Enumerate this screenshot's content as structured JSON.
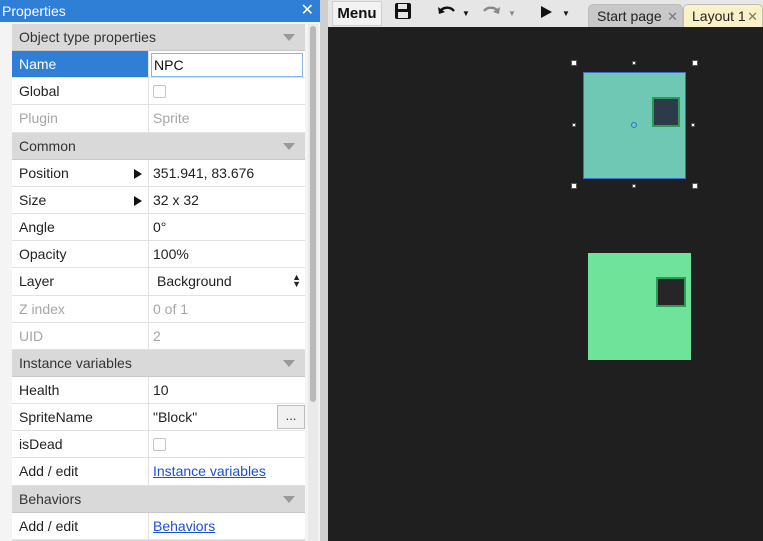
{
  "panel": {
    "title": "Properties",
    "close_glyph": "✕",
    "sections": {
      "object_type": "Object type properties",
      "common": "Common",
      "instance_vars": "Instance variables",
      "behaviors": "Behaviors"
    },
    "object_type": {
      "name_label": "Name",
      "name_value": "NPC",
      "global_label": "Global",
      "global_checked": false,
      "plugin_label": "Plugin",
      "plugin_value": "Sprite"
    },
    "common": {
      "position_label": "Position",
      "position_value": "351.941, 83.676",
      "size_label": "Size",
      "size_value": "32 x 32",
      "angle_label": "Angle",
      "angle_value": "0°",
      "opacity_label": "Opacity",
      "opacity_value": "100%",
      "layer_label": "Layer",
      "layer_value": "Background",
      "zindex_label": "Z index",
      "zindex_value": "0 of 1",
      "uid_label": "UID",
      "uid_value": "2"
    },
    "instance_vars": {
      "health_label": "Health",
      "health_value": "10",
      "spritename_label": "SpriteName",
      "spritename_value": "\"Block\"",
      "spritename_button": "...",
      "isdead_label": "isDead",
      "isdead_checked": false,
      "addedit_label": "Add / edit",
      "addedit_link": "Instance variables"
    },
    "behaviors": {
      "addedit_label": "Add / edit",
      "addedit_link": "Behaviors"
    }
  },
  "toolbar": {
    "menu_label": "Menu",
    "icons": [
      "save-icon",
      "undo-icon",
      "redo-icon",
      "play-icon"
    ],
    "tabs": [
      {
        "label": "Start page",
        "active": false
      },
      {
        "label": "Layout 1",
        "active": true
      }
    ],
    "tab_close_glyph": "✕"
  },
  "colors": {
    "accent": "#2f7fd6",
    "canvas_bg": "#1f1f1f",
    "selected_sprite": "#6ec8b4",
    "other_sprite": "#6fe39a",
    "sprite_eye": "#2b2b2b"
  }
}
